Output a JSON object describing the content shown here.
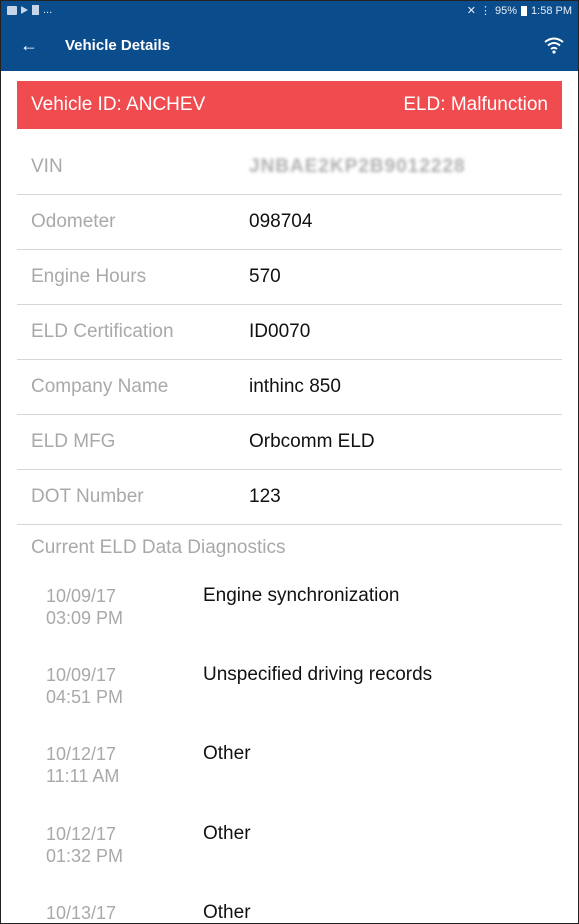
{
  "status_bar": {
    "left_icons": [
      "image-icon",
      "play-icon",
      "flag-icon"
    ],
    "left_ellipsis": "...",
    "right_text": "95%",
    "time": "1:58 PM"
  },
  "app_bar": {
    "back_icon": "arrow-left-icon",
    "title": "Vehicle Details",
    "wifi_icon": "wifi-icon"
  },
  "banner": {
    "vehicle_id": "Vehicle ID: ANCHEV",
    "eld_status": "ELD: Malfunction",
    "color": "#f04b4e"
  },
  "details": [
    {
      "label": "VIN",
      "value": "JNBAE2KP2B9012228"
    },
    {
      "label": "Odometer",
      "value": "098704"
    },
    {
      "label": "Engine Hours",
      "value": "570"
    },
    {
      "label": "ELD Certification",
      "value": "ID0070"
    },
    {
      "label": "Company Name",
      "value": "inthinc 850"
    },
    {
      "label": "ELD MFG",
      "value": "Orbcomm ELD"
    },
    {
      "label": "DOT Number",
      "value": "123"
    }
  ],
  "diagnostics": {
    "title": "Current ELD Data Diagnostics",
    "items": [
      {
        "date": "10/09/17",
        "time": "03:09 PM",
        "description": "Engine synchronization"
      },
      {
        "date": "10/09/17",
        "time": "04:51 PM",
        "description": "Unspecified driving records"
      },
      {
        "date": "10/12/17",
        "time": "11:11 AM",
        "description": "Other"
      },
      {
        "date": "10/12/17",
        "time": "01:32 PM",
        "description": "Other"
      },
      {
        "date": "10/13/17",
        "time": "",
        "description": "Other"
      }
    ]
  },
  "colors": {
    "primary": "#0b4c8c",
    "alert": "#f04b4e"
  }
}
